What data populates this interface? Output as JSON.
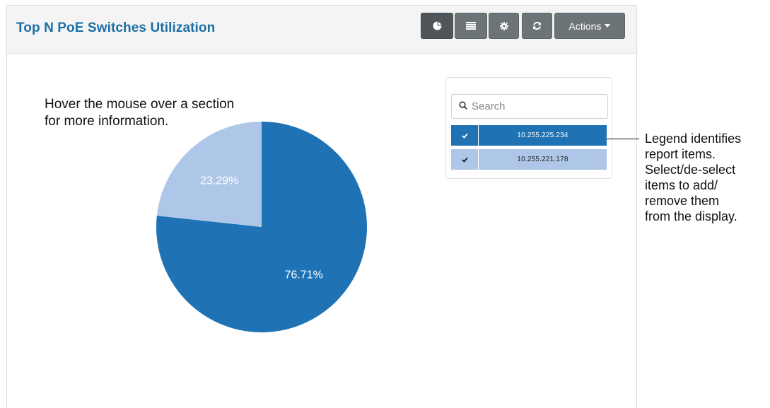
{
  "panel": {
    "title": "Top N PoE Switches Utilization",
    "toolbar": {
      "pie_icon": "pie-chart-icon",
      "table_icon": "table-icon",
      "settings_icon": "gear-icon",
      "refresh_icon": "refresh-icon",
      "actions_label": "Actions"
    }
  },
  "hint": {
    "line1": "Hover the mouse over a section",
    "line2": "for more information."
  },
  "legend": {
    "search_placeholder": "Search",
    "items": [
      {
        "label": "10.255.225.234",
        "checked": true,
        "color": "#1f73b4",
        "text_color": "#ffffff"
      },
      {
        "label": "10.255.221.178",
        "checked": true,
        "color": "#aec7e8",
        "text_color": "#1a1a1a"
      }
    ]
  },
  "chart_data": {
    "type": "pie",
    "title": "",
    "slices": [
      {
        "name": "10.255.225.234",
        "value": 76.71,
        "label": "76.71%",
        "color": "#1f73b4"
      },
      {
        "name": "10.255.221.178",
        "value": 23.29,
        "label": "23.29%",
        "color": "#aec7e8"
      }
    ]
  },
  "annotation": {
    "lines": [
      "Legend identifies",
      "report items.",
      "Select/de-select",
      "items to add/",
      "remove them",
      "from the display."
    ]
  }
}
